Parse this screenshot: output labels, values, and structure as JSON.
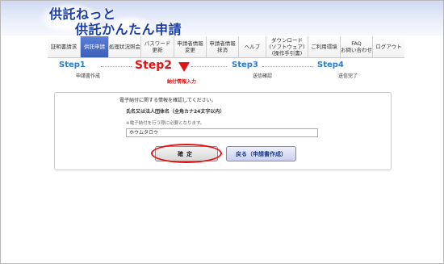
{
  "header": {
    "title_line1": "供託ねっと",
    "title_line2": "供託かんたん申請"
  },
  "nav": {
    "items": [
      {
        "label": "証明書請求"
      },
      {
        "label": "供託申請"
      },
      {
        "label": "処理状況照会"
      },
      {
        "label": "パスワード\n更新"
      },
      {
        "label": "申請者情報\n変更"
      },
      {
        "label": "申請者情報\n抹消"
      },
      {
        "label": "ヘルプ"
      },
      {
        "label": "ダウンロード\n(ソフトウェア)\n(操作手引書)"
      },
      {
        "label": "ご利用環境"
      },
      {
        "label": "FAQ\nお問い合わせ"
      },
      {
        "label": "ログアウト"
      }
    ],
    "active_index": 1
  },
  "steps": [
    {
      "title": "Step1",
      "sub": "申請書作成"
    },
    {
      "title": "Step2",
      "sub": "納付情報入力"
    },
    {
      "title": "Step3",
      "sub": "送信確認"
    },
    {
      "title": "Step4",
      "sub": "送信完了"
    }
  ],
  "form": {
    "intro": "電子納付に関する情報を確認してください。",
    "field_label": "氏名又は法人団体名（全角カナ24文字以内）",
    "note": "※電子納付を行う際に必要となります。",
    "input_value": "ホウムタロウ"
  },
  "buttons": {
    "confirm": "確定",
    "back": "戻る（申請書作成）"
  },
  "colors": {
    "brand": "#1a3fa8",
    "step_done": "#2c7dc4",
    "current": "#e51414",
    "nav_active": "#3b5fb8"
  }
}
